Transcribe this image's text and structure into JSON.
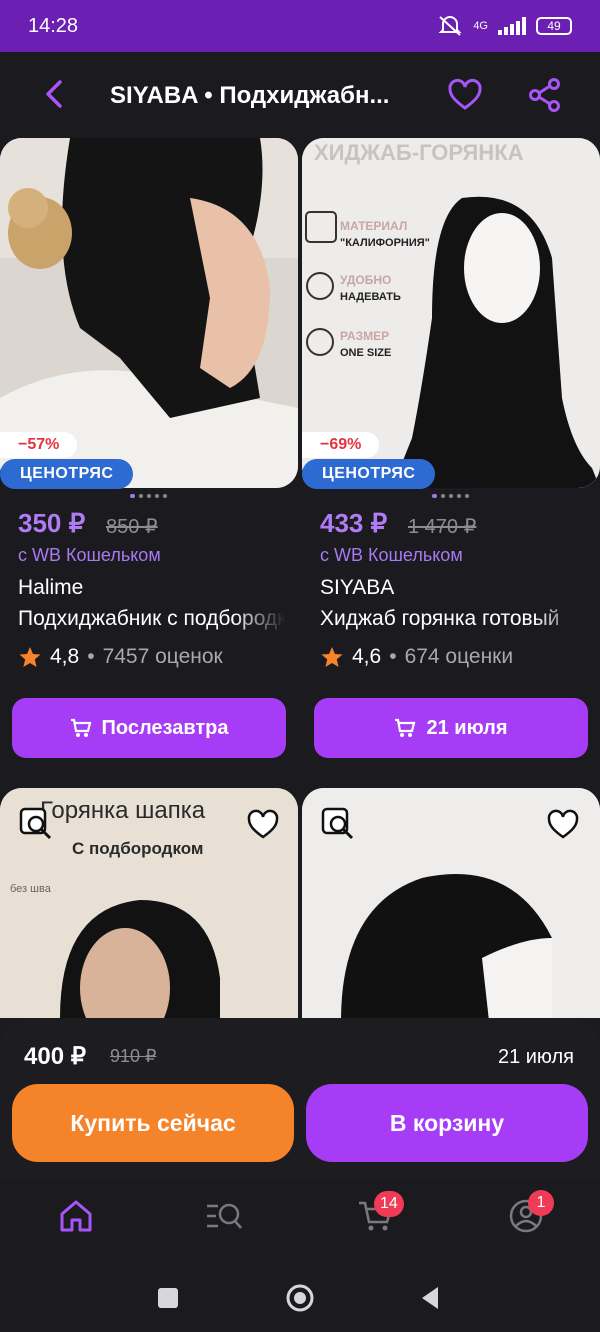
{
  "status_bar": {
    "time": "14:28",
    "network": "4G",
    "battery": "49"
  },
  "header": {
    "title": "SIYABA • Подхиджабн..."
  },
  "products": [
    {
      "discount": "−57%",
      "badge": "ЦЕНОТРЯС",
      "price": "350 ₽",
      "old_price": "850 ₽",
      "wallet_note": "с WB Кошельком",
      "brand": "Halime",
      "name": "Подхиджабник с подбородком",
      "rating": "4,8",
      "reviews": "7457 оценок",
      "delivery": "Послезавтра"
    },
    {
      "discount": "−69%",
      "badge": "ЦЕНОТРЯС",
      "price": "433 ₽",
      "old_price": "1 470 ₽",
      "wallet_note": "с WB Кошельком",
      "brand": "SIYABA",
      "name": "Хиджаб горянка готовый",
      "rating": "4,6",
      "reviews": "674 оценки",
      "delivery": "21 июля",
      "image_text": {
        "banner": "ХИДЖАБ-ГОРЯНКА",
        "material_label": "МАТЕРИАЛ",
        "material_value": "\"КАЛИФОРНИЯ\"",
        "easy_label": "УДОБНО",
        "easy_value": "НАДЕВАТЬ",
        "size_label": "РАЗМЕР",
        "size_value": "ONE SIZE"
      }
    }
  ],
  "next_row": [
    {
      "image_title": "Горянка шапка",
      "image_subtitle": "С подбородком",
      "image_note": "без шва"
    },
    {}
  ],
  "bottom_sheet": {
    "price": "400 ₽",
    "old_price": "910 ₽",
    "delivery": "21 июля",
    "buy_now": "Купить сейчас",
    "add_to_cart": "В корзину"
  },
  "tab_bar": {
    "cart_count": "14",
    "profile_count": "1"
  },
  "colors": {
    "accent": "#a63cf5",
    "orange": "#f5832a",
    "status_bar": "#6c1fb3",
    "price": "#b07cf5"
  }
}
